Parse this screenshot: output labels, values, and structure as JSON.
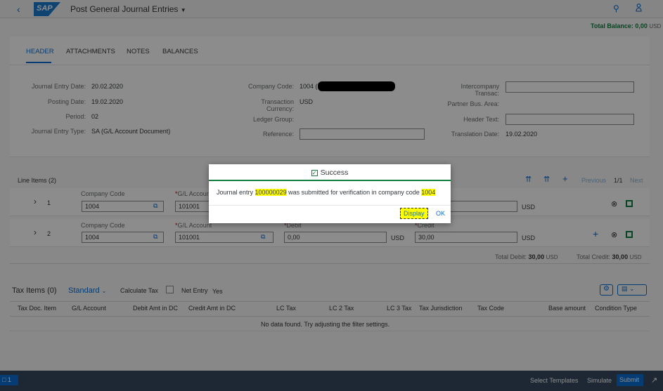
{
  "shell": {
    "title": "Post General Journal Entries"
  },
  "balance": {
    "label": "Total Balance:",
    "value": "0,00",
    "currency": "USD"
  },
  "tabs": [
    "HEADER",
    "ATTACHMENTS",
    "NOTES",
    "BALANCES"
  ],
  "header": {
    "journal_entry_date_label": "Journal Entry Date:",
    "journal_entry_date": "20.02.2020",
    "posting_date_label": "Posting Date:",
    "posting_date": "19.02.2020",
    "period_label": "Period:",
    "period": "02",
    "journal_entry_type_label": "Journal Entry Type:",
    "journal_entry_type": "SA (G/L Account Document)",
    "company_code_label": "Company Code:",
    "company_code": "1004 (",
    "transaction_currency_label": "Transaction Currency:",
    "transaction_currency": "USD",
    "ledger_group_label": "Ledger Group:",
    "reference_label": "Reference:",
    "intercompany_label": "Intercompany Transac:",
    "partner_bus_area_label": "Partner Bus. Area:",
    "header_text_label": "Header Text:",
    "translation_date_label": "Translation Date:",
    "translation_date": "19.02.2020"
  },
  "line_items": {
    "title": "Line Items (2)",
    "pagination": {
      "previous": "Previous",
      "page": "1/1",
      "next": "Next"
    },
    "col_company_code": "Company Code",
    "col_gl_account": "G/L Account",
    "col_debit": "Debit",
    "col_credit": "Credit",
    "required_mark": "*",
    "rows": [
      {
        "num": "1",
        "company_code": "1004",
        "gl_account": "101001",
        "debit": "",
        "credit": "",
        "currency": "USD"
      },
      {
        "num": "2",
        "company_code": "1004",
        "gl_account": "101001",
        "debit": "0,00",
        "credit": "30,00",
        "debit_currency": "USD",
        "currency": "USD"
      }
    ],
    "total_debit_label": "Total Debit:",
    "total_debit": "30,00",
    "total_debit_currency": "USD",
    "total_credit_label": "Total Credit:",
    "total_credit": "30,00",
    "total_credit_currency": "USD"
  },
  "tax_items": {
    "title": "Tax Items (0)",
    "variant": "Standard",
    "calculate_tax_label": "Calculate Tax",
    "net_entry_label": "Net Entry",
    "net_entry_value": "Yes",
    "columns": [
      "Tax Doc. Item",
      "G/L Account",
      "Debit Amt in DC",
      "Credit Amt in DC",
      "LC Tax",
      "LC 2 Tax",
      "LC 3 Tax",
      "Tax Jurisdiction",
      "Tax Code",
      "Base amount",
      "Condition Type"
    ],
    "no_data": "No data found. Try adjusting the filter settings."
  },
  "dialog": {
    "title": "Success",
    "message_pre": "Journal entry",
    "doc_number": "100000029",
    "message_mid": "was submitted for verification in company code",
    "company": "1004",
    "display_button": "Display",
    "ok_button": "OK"
  },
  "footer": {
    "messages_count": "1",
    "select_templates": "Select Templates",
    "simulate": "Simulate",
    "submit": "Submit"
  },
  "colors": {
    "accent": "#0a6ed1",
    "success": "#107e3e",
    "highlight": "#ffff00",
    "footer": "#354a5f"
  }
}
